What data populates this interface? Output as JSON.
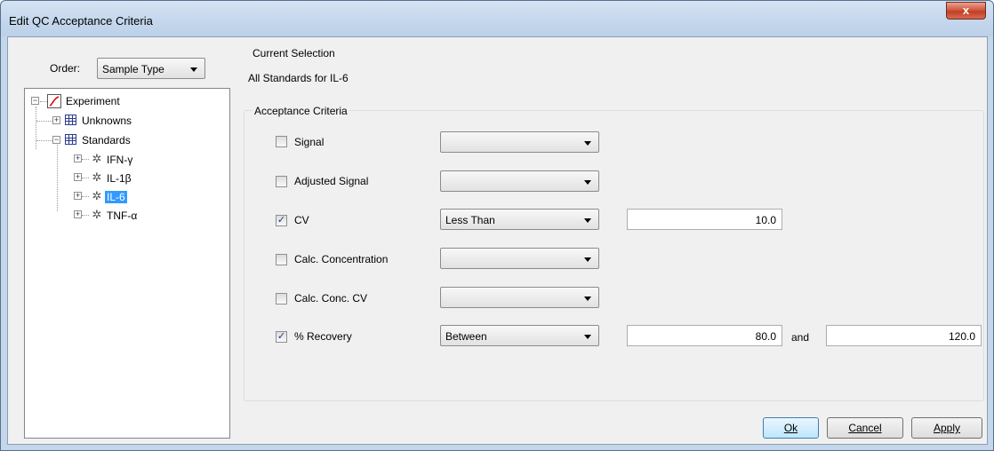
{
  "window": {
    "title": "Edit QC Acceptance Criteria",
    "close_label": "x"
  },
  "order": {
    "label": "Order:",
    "value": "Sample Type"
  },
  "tree": {
    "root": "Experiment",
    "unknowns": "Unknowns",
    "standards": "Standards",
    "analytes": [
      "IFN-γ",
      "IL-1β",
      "IL-6",
      "TNF-α"
    ],
    "selected_index": 2
  },
  "current_selection": {
    "title": "Current Selection",
    "value": "All Standards for IL-6"
  },
  "criteria": {
    "title": "Acceptance Criteria",
    "rows": [
      {
        "label": "Signal",
        "checked": false,
        "op": ""
      },
      {
        "label": "Adjusted Signal",
        "checked": false,
        "op": ""
      },
      {
        "label": "CV",
        "checked": true,
        "op": "Less Than",
        "value1": "10.0"
      },
      {
        "label": "Calc. Concentration",
        "checked": false,
        "op": ""
      },
      {
        "label": "Calc. Conc. CV",
        "checked": false,
        "op": ""
      },
      {
        "label": "% Recovery",
        "checked": true,
        "op": "Between",
        "value1": "80.0",
        "and": "and",
        "value2": "120.0"
      }
    ]
  },
  "buttons": {
    "ok": "Ok",
    "cancel": "Cancel",
    "apply": "Apply"
  }
}
